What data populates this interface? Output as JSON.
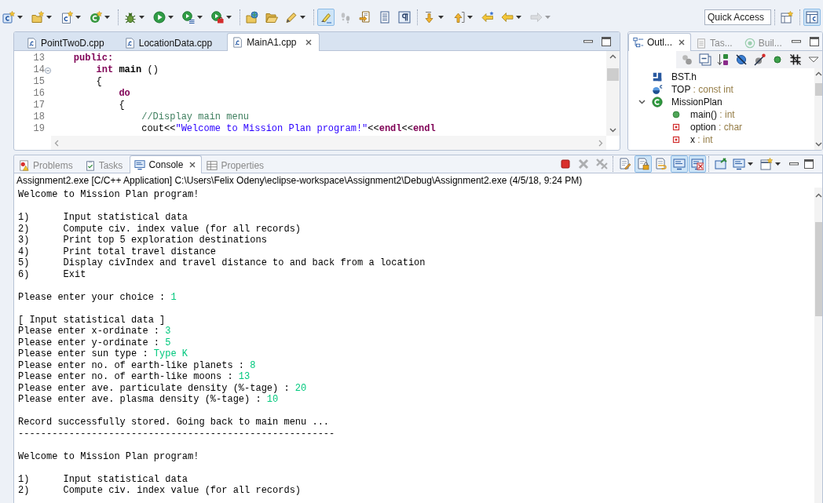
{
  "toolbar": {
    "groups": [
      [
        {
          "dropdown": true,
          "pressed": false,
          "disabled": false
        },
        {
          "dropdown": true,
          "pressed": false,
          "disabled": false
        },
        {
          "dropdown": true,
          "pressed": false,
          "disabled": false
        },
        {
          "dropdown": true,
          "pressed": false,
          "disabled": false
        }
      ],
      [
        {
          "dropdown": true,
          "pressed": false,
          "disabled": false
        },
        {
          "dropdown": true,
          "pressed": false,
          "disabled": false
        },
        {
          "dropdown": true,
          "pressed": false,
          "disabled": false
        },
        {
          "dropdown": true,
          "pressed": false,
          "disabled": false
        }
      ],
      [
        {
          "dropdown": false,
          "pressed": false,
          "disabled": false
        },
        {
          "dropdown": false,
          "pressed": false,
          "disabled": false
        },
        {
          "dropdown": true,
          "pressed": false,
          "disabled": false
        }
      ],
      [
        {
          "dropdown": false,
          "pressed": true,
          "disabled": false
        },
        {
          "dropdown": false,
          "pressed": false,
          "disabled": true
        },
        {
          "dropdown": false,
          "pressed": false,
          "disabled": false
        },
        {
          "dropdown": false,
          "pressed": false,
          "disabled": false
        },
        {
          "dropdown": false,
          "pressed": false,
          "disabled": false
        }
      ],
      [
        {
          "dropdown": true,
          "pressed": false,
          "disabled": false
        },
        {
          "dropdown": true,
          "pressed": false,
          "disabled": false
        },
        {
          "dropdown": false,
          "pressed": false,
          "disabled": false
        },
        {
          "dropdown": true,
          "pressed": false,
          "disabled": false
        },
        {
          "dropdown": true,
          "pressed": false,
          "disabled": true
        }
      ]
    ],
    "quick_access": {
      "placeholder": "Quick Access"
    },
    "perspectives": [
      {
        "selected": true
      }
    ]
  },
  "editor": {
    "tabs": [
      {
        "label": "PointTwoD.cpp",
        "selected": false
      },
      {
        "label": "LocationData.cpp",
        "selected": false
      },
      {
        "label": "MainA1.cpp",
        "selected": true
      }
    ],
    "lines": [
      {
        "number": "13",
        "fold": false,
        "tokens": [
          {
            "kind": "keyword",
            "text": "    public:"
          }
        ]
      },
      {
        "number": "14",
        "fold": true,
        "tokens": [
          {
            "kind": "keyword",
            "text": "        int"
          },
          {
            "kind": "function",
            "text": " main"
          },
          {
            "kind": "plain",
            "text": " ()"
          }
        ]
      },
      {
        "number": "15",
        "fold": false,
        "tokens": [
          {
            "kind": "plain",
            "text": "        {"
          }
        ]
      },
      {
        "number": "16",
        "fold": false,
        "tokens": [
          {
            "kind": "keyword",
            "text": "            do"
          }
        ]
      },
      {
        "number": "17",
        "fold": false,
        "tokens": [
          {
            "kind": "plain",
            "text": "            {"
          }
        ]
      },
      {
        "number": "18",
        "fold": false,
        "tokens": [
          {
            "kind": "comment",
            "text": "                //Display main menu"
          }
        ]
      },
      {
        "number": "19",
        "fold": false,
        "tokens": [
          {
            "kind": "plain",
            "text": "                cout<<"
          },
          {
            "kind": "string",
            "text": "\"Welcome to Mission Plan program!\""
          },
          {
            "kind": "plain",
            "text": "<<"
          },
          {
            "kind": "keyword",
            "text": "endl"
          },
          {
            "kind": "plain",
            "text": "<<"
          },
          {
            "kind": "keyword",
            "text": "endl"
          }
        ]
      }
    ]
  },
  "outline": {
    "tabs": [
      {
        "label": "Outl...",
        "selected": true
      },
      {
        "label": "Tas...",
        "selected": false
      },
      {
        "label": "Buil...",
        "selected": false
      }
    ],
    "tree": [
      {
        "kind": "include",
        "name": "BST.h"
      },
      {
        "kind": "variable",
        "name": "TOP",
        "type": ": const int"
      },
      {
        "kind": "class",
        "name": "MissionPlan",
        "expanded": true,
        "children": [
          {
            "kind": "method",
            "name": "main()",
            "type": ": int"
          },
          {
            "kind": "field",
            "name": "option",
            "type": ": char"
          },
          {
            "kind": "field",
            "name": "x",
            "type": ": int"
          }
        ]
      }
    ]
  },
  "console": {
    "tabs": [
      {
        "label": "Problems",
        "selected": false
      },
      {
        "label": "Tasks",
        "selected": false
      },
      {
        "label": "Console",
        "selected": true
      },
      {
        "label": "Properties",
        "selected": false
      }
    ],
    "toolbar": [
      [
        {
          "dropdown": false,
          "pressed": false,
          "disabled": false
        },
        {
          "dropdown": false,
          "pressed": false,
          "disabled": true
        },
        {
          "dropdown": false,
          "pressed": false,
          "disabled": true
        }
      ],
      [
        {
          "dropdown": false,
          "pressed": false,
          "disabled": false
        },
        {
          "dropdown": false,
          "pressed": true,
          "disabled": false
        },
        {
          "dropdown": false,
          "pressed": false,
          "disabled": false
        },
        {
          "dropdown": false,
          "pressed": true,
          "disabled": false
        },
        {
          "dropdown": false,
          "pressed": true,
          "disabled": false
        }
      ],
      [
        {
          "dropdown": false,
          "pressed": false,
          "disabled": false
        },
        {
          "dropdown": true,
          "pressed": false,
          "disabled": false
        },
        {
          "dropdown": true,
          "pressed": false,
          "disabled": false
        }
      ]
    ],
    "process": "Assignment2.exe [C/C++ Application] C:\\Users\\Felix Odeny\\eclipse-workspace\\Assignment2\\Debug\\Assignment2.exe (4/5/18, 9:24 PM)",
    "blocks": [
      [
        {
          "kind": "plain",
          "text": "Welcome to Mission Plan program!"
        }
      ],
      [
        {
          "kind": "menu",
          "number": "1)",
          "text": "Input statistical data"
        },
        {
          "kind": "menu",
          "number": "2)",
          "text": "Compute civ. index value (for all records)"
        },
        {
          "kind": "menu",
          "number": "3)",
          "text": "Print top 5 exploration destinations"
        },
        {
          "kind": "menu",
          "number": "4)",
          "text": "Print total travel distance"
        },
        {
          "kind": "menu",
          "number": "5)",
          "text": "Display civIndex and travel distance to and back from a location"
        },
        {
          "kind": "menu",
          "number": "6)",
          "text": "Exit"
        }
      ],
      [
        {
          "kind": "prompt",
          "text": "Please enter your choice :",
          "input": "1"
        }
      ],
      [
        {
          "kind": "plain",
          "text": "[ Input statistical data ]"
        },
        {
          "kind": "prompt",
          "text": "Please enter x-ordinate :",
          "input": "3"
        },
        {
          "kind": "prompt",
          "text": "Please enter y-ordinate :",
          "input": "5"
        },
        {
          "kind": "prompt",
          "text": "Please enter sun type :",
          "input": "Type K"
        },
        {
          "kind": "prompt",
          "text": "Please enter no. of earth-like planets :",
          "input": "8"
        },
        {
          "kind": "prompt",
          "text": "Please enter no. of earth-like moons :",
          "input": "13"
        },
        {
          "kind": "prompt",
          "text": "Please enter ave. particulate density (%-tage) :",
          "input": "20"
        },
        {
          "kind": "prompt",
          "text": "Please enter ave. plasma density (%-tage) :",
          "input": "10"
        }
      ],
      [
        {
          "kind": "plain",
          "text": "Record successfully stored. Going back to main menu ..."
        },
        {
          "kind": "plain",
          "text": "--------------------------------------------------------"
        }
      ],
      [
        {
          "kind": "plain",
          "text": "Welcome to Mission Plan program!"
        }
      ],
      [
        {
          "kind": "menu",
          "number": "1)",
          "text": "Input statistical data"
        },
        {
          "kind": "menu",
          "number": "2)",
          "text": "Compute civ. index value (for all records)"
        }
      ]
    ]
  }
}
